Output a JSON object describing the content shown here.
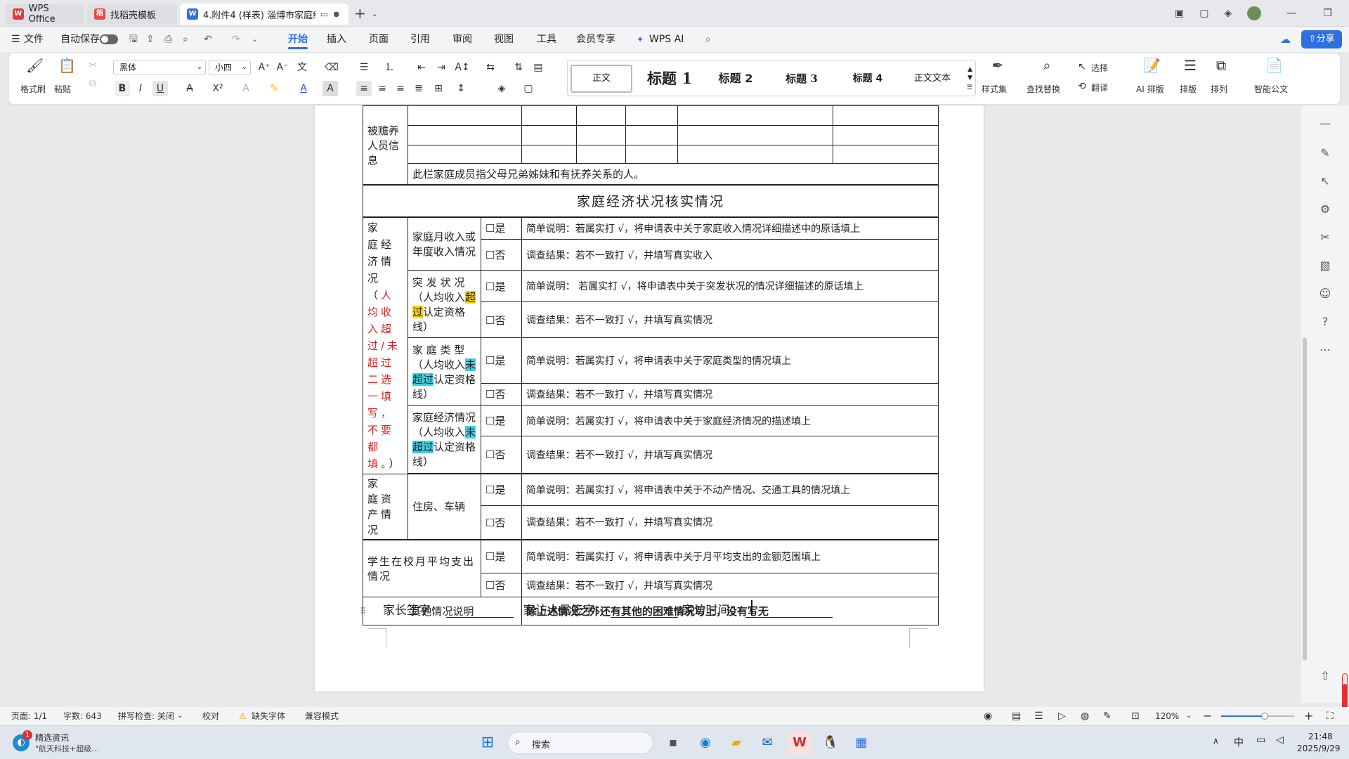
{
  "tabs": [
    {
      "label": "WPS Office"
    },
    {
      "label": "找稻壳模板"
    },
    {
      "label": "4.附件4 (样表) 淄博市家庭经"
    }
  ],
  "menubar": {
    "file": "文件",
    "autosave": "自动保存",
    "tabs": [
      "开始",
      "插入",
      "页面",
      "引用",
      "审阅",
      "视图",
      "工具",
      "会员专享",
      "WPS AI"
    ],
    "share": "分享"
  },
  "ribbon": {
    "format_painter": "格式刷",
    "paste": "粘贴",
    "font": "黑体",
    "font_size": "小四",
    "styles": [
      "正文",
      "标题 1",
      "标题 2",
      "标题 3",
      "标题 4",
      "正文文本"
    ],
    "style_set": "样式集",
    "find_replace": "查找替换",
    "select": "选择",
    "translate": "翻译",
    "ai_layout": "AI 排版",
    "layout": "排版",
    "arrange": "排列",
    "smart_doc": "智能公文"
  },
  "doc": {
    "dependent_label": "被赡养人员信息",
    "dependent_note": "此栏家庭成员指父母兄弟姊妹和有抚养关系的人。",
    "section_title": "家庭经济状况核实情况",
    "econ_prefix": "家　庭经　济情　况（",
    "econ_red": "人均收入超过/未超过二选一填写，不要都填。",
    "econ_suffix": "）",
    "rows": [
      {
        "label": "家庭月收入或年度收入情况",
        "yes": "☐是",
        "no": "☐否",
        "note_yes": "简单说明：若属实打 √，将申请表中关于家庭收入情况详细描述中的原话填上",
        "note_no": "调查结果：若不一致打 √，并填写真实收入"
      },
      {
        "label_a": "突 发 状 况（人均收入",
        "label_hl": "超过",
        "label_b": "认定资格线）",
        "yes": "☐是",
        "no": "☐否",
        "note_yes": "简单说明： 若属实打 √，将申请表中关于突发状况的情况详细描述的原话填上",
        "note_no": "调查结果：若不一致打 √，并填写真实情况"
      },
      {
        "label_a": "家 庭 类 型（人均收入",
        "label_hl": "未超过",
        "label_b": "认定资格线）",
        "yes": "☐是",
        "no": "☐否",
        "note_yes": "简单说明：若属实打 √，将申请表中关于家庭类型的情况填上",
        "note_no": "调查结果：若不一致打 √，并填写真实情况"
      },
      {
        "label_a": "家庭经济情况（人均收入",
        "label_hl": "未超过",
        "label_b": "认定资格线）",
        "yes": "☐是",
        "no": "☐否",
        "note_yes": "简单说明：若属实打 √，将申请表中关于家庭经济情况的描述填上",
        "note_no": "调查结果：若不一致打 √，并填写真实情况"
      }
    ],
    "asset_label": "家　庭资　产情况",
    "asset_item": "住房、车辆",
    "asset_yes": "☐是",
    "asset_no": "☐否",
    "asset_note_yes": "简单说明：若属实打 √，将申请表中关于不动产情况、交通工具的情况填上",
    "asset_note_no": "调查结果：若不一致打 √，并填写真实情况",
    "student_label": "学生在校月平均支出情况",
    "student_yes": "☐是",
    "student_no": "☐否",
    "student_note_yes": "简单说明：若属实打 √，将申请表中关于月平均支出的金额范围填上",
    "student_note_no": "调查结果：若不一致打 √，并填写真实情况",
    "other_label": "其他情况说明",
    "other_text": "除上述情况之外还有其他的困难情况写上，没有写无",
    "sign_parent": "家长签字：",
    "sign_visitor": "家访人员签字：",
    "visit_time": "家访时间："
  },
  "status": {
    "page": "页面: 1/1",
    "words": "字数: 643",
    "spell": "拼写检查: 关闭",
    "proof": "校对",
    "missing_font": "缺失字体",
    "compat": "兼容模式",
    "zoom": "120%",
    "zoom_fraction": 0.6
  },
  "taskbar": {
    "news_title": "精选资讯",
    "news_sub": "\"航天科技+超级...",
    "badge": "1",
    "search": "搜索",
    "ime": "中",
    "time": "21:48",
    "date": "2025/9/29"
  }
}
